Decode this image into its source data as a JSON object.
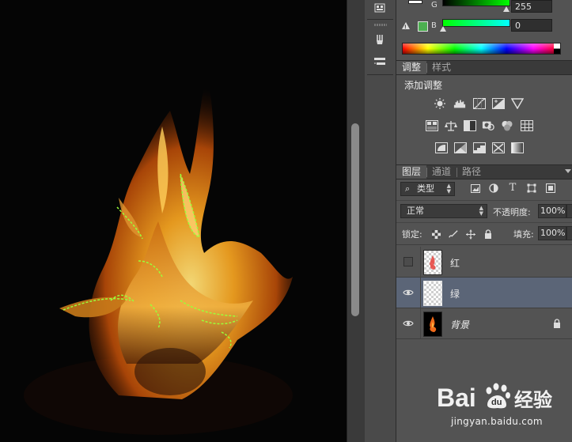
{
  "color_panel": {
    "channels": [
      {
        "label": "G",
        "value": "255"
      },
      {
        "label": "B",
        "value": "0"
      }
    ],
    "colors": {
      "green": "#00ff00",
      "accent_swatch": "#4caf50"
    }
  },
  "adjustments": {
    "tabs": [
      "调整",
      "样式"
    ],
    "title": "添加调整",
    "row1_icons": [
      "brightness-contrast-icon",
      "levels-icon",
      "curves-icon",
      "exposure-icon",
      "gradient-triangle-icon"
    ],
    "row2_icons": [
      "vibrance-icon",
      "color-balance-icon",
      "black-white-icon",
      "photo-filter-icon",
      "channel-mixer-icon",
      "color-lookup-icon"
    ],
    "row3_icons": [
      "invert-icon",
      "posterize-icon",
      "threshold-icon",
      "selective-color-icon",
      "gradient-map-icon"
    ]
  },
  "layers": {
    "tabs": [
      "图层",
      "通道",
      "路径"
    ],
    "filter_label": "类型",
    "blend_mode": "正常",
    "opacity_label": "不透明度:",
    "opacity_value": "100%",
    "lock_label": "锁定:",
    "fill_label": "填充:",
    "fill_value": "100%",
    "items": [
      {
        "name": "红",
        "visible": false
      },
      {
        "name": "绿",
        "visible": true
      },
      {
        "name": "背景",
        "visible": true
      }
    ]
  },
  "watermark": {
    "site": "jingyan.baidu.com"
  }
}
